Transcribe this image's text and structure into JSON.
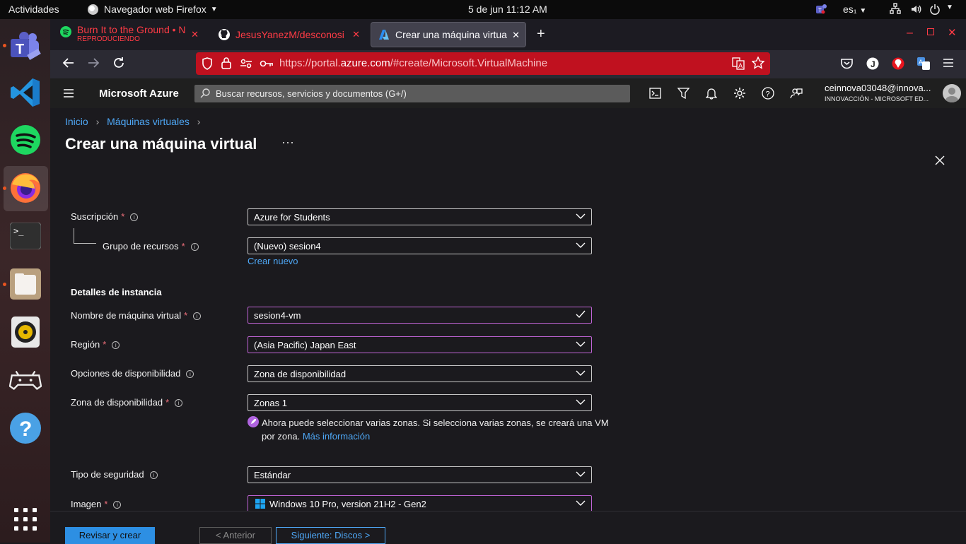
{
  "topbar": {
    "activities": "Actividades",
    "app": "Navegador web Firefox",
    "datetime": "5 de jun  11:12 AM",
    "lang": "es₁"
  },
  "tabs": [
    {
      "title": "Burn It to the Ground • N",
      "subtitle": "REPRODUCIENDO"
    },
    {
      "title": "JesusYanezM/desconosi"
    },
    {
      "title": "Crear una máquina virtua"
    }
  ],
  "url": {
    "prefix": "https://portal.",
    "domain": "azure.com",
    "path": "/#create/Microsoft.VirtualMachine"
  },
  "azure": {
    "brand": "Microsoft Azure",
    "search_placeholder": "Buscar recursos, servicios y documentos (G+/)",
    "account_name": "ceinnova03048@innova...",
    "account_org": "INNOVACCIÓN - MICROSOFT ED..."
  },
  "breadcrumb": {
    "home": "Inicio",
    "vms": "Máquinas virtuales"
  },
  "page": {
    "title": "Crear una máquina virtual",
    "more": "···"
  },
  "form": {
    "subscription": {
      "label": "Suscripción",
      "value": "Azure for Students"
    },
    "resource_group": {
      "label": "Grupo de recursos",
      "value": "(Nuevo) sesion4",
      "create_new": "Crear nuevo"
    },
    "instance_section": "Detalles de instancia",
    "vm_name": {
      "label": "Nombre de máquina virtual",
      "value": "sesion4-vm"
    },
    "region": {
      "label": "Región",
      "value": "(Asia Pacific) Japan East"
    },
    "availability_options": {
      "label": "Opciones de disponibilidad",
      "value": "Zona de disponibilidad"
    },
    "availability_zone": {
      "label": "Zona de disponibilidad",
      "value": "Zonas 1"
    },
    "zone_note_line1": "Ahora puede seleccionar varias zonas. Si selecciona varias zonas, se creará una VM",
    "zone_note_line2": "por zona.",
    "zone_note_link": "Más información",
    "security_type": {
      "label": "Tipo de seguridad",
      "value": "Estándar"
    },
    "image": {
      "label": "Imagen",
      "value": "Windows 10 Pro, version 21H2 - Gen2"
    }
  },
  "footer": {
    "review": "Revisar y crear",
    "prev": "< Anterior",
    "next": "Siguiente: Discos >"
  },
  "colors": {
    "azure_blue": "#0f6cbd",
    "link": "#4ea7f5",
    "url_bar": "#c0111f",
    "focus": "#c064d6",
    "required": "#f1707b"
  }
}
